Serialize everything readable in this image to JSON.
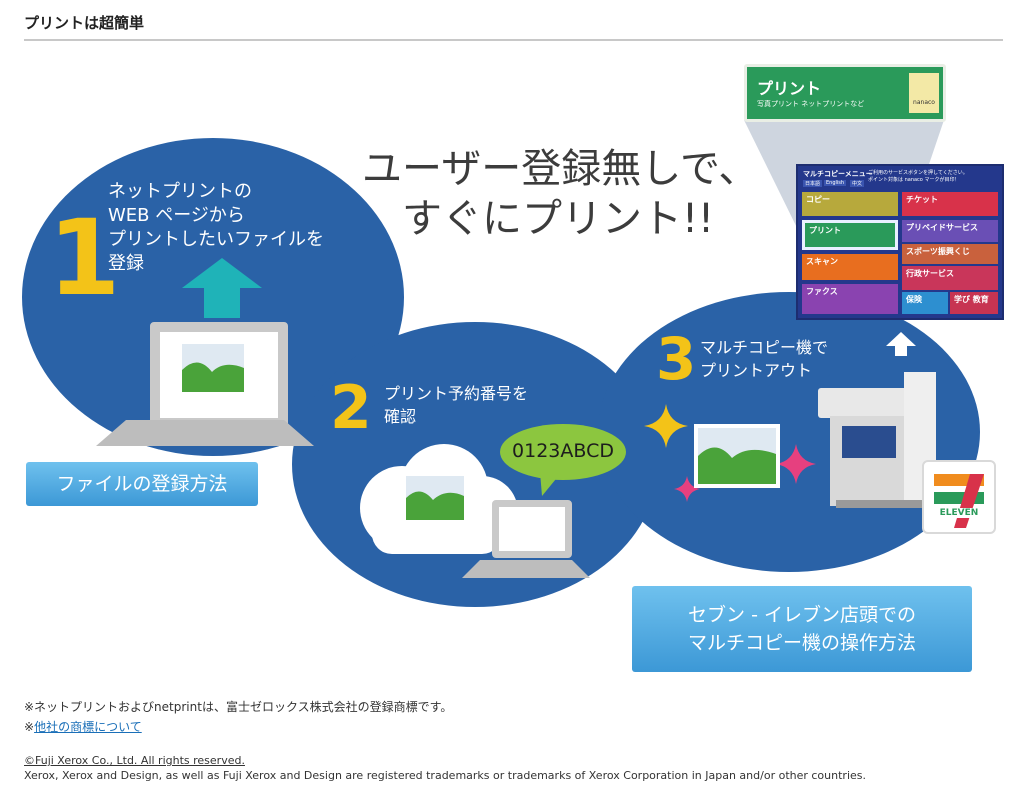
{
  "page": {
    "title": "プリントは超簡単"
  },
  "headline": {
    "line1": "ユーザー登録無しで、",
    "line2": "すぐにプリント!!"
  },
  "steps": [
    {
      "number": "1",
      "lines": [
        "ネットプリントの",
        "WEB ページから",
        "プリントしたいファイルを",
        "登録"
      ]
    },
    {
      "number": "2",
      "lines": [
        "プリント予約番号を",
        "確認"
      ]
    },
    {
      "number": "3",
      "lines": [
        "マルチコピー機で",
        "プリントアウト"
      ]
    }
  ],
  "reservation_code": "0123ABCD",
  "buttons": {
    "file_registration": "ファイルの登録方法",
    "seven_eleven_line1": "セブン - イレブン店頭での",
    "seven_eleven_line2": "マルチコピー機の操作方法"
  },
  "menu": {
    "zoom_title": "プリント",
    "zoom_subtitle": "写真プリント  ネットプリントなど",
    "header": "マルチコピーメニュー",
    "header_note_1": "ご利用のサービスボタンを押してください。",
    "header_note_2": "ポイント対象は nanaco マークが目印！",
    "lang_tabs": [
      "日本語",
      "English",
      "中文"
    ],
    "tiles": [
      {
        "label": "コピー",
        "color": "#b7a93c"
      },
      {
        "label": "チケット",
        "color": "#d8324a"
      },
      {
        "label": "プリント",
        "color": "#2a9a5a"
      },
      {
        "label": "プリペイドサービス",
        "color": "#6a4fb5"
      },
      {
        "label": "スキャン",
        "color": "#e86e1f"
      },
      {
        "label": "スポーツ振興くじ",
        "color": "#c9613d"
      },
      {
        "label": "ファクス",
        "color": "#8a43b0"
      },
      {
        "label": "行政サービス",
        "color": "#c9365a"
      },
      {
        "label": "保険",
        "color": "#2d8fd0"
      },
      {
        "label": "学び 教育",
        "color": "#c73452"
      }
    ],
    "nanaco": "nanaco"
  },
  "logo": {
    "text": "ELEVEN"
  },
  "notes": {
    "trademark_line": "※ネットプリントおよびnetprintは、富士ゼロックス株式会社の登録商標です。",
    "other_prefix": "※",
    "other_link": "他社の商標について"
  },
  "footer": {
    "copyright": "©Fuji Xerox Co., Ltd. All rights reserved.",
    "trademark": "Xerox, Xerox and Design, as well as Fuji Xerox and Design are registered trademarks or trademarks of Xerox Corporation in Japan and/or other countries."
  },
  "colors": {
    "blob": "#2a62a7",
    "step_number": "#f3c318",
    "arrow": "#1fb3b8",
    "button_top": "#6fc1ee",
    "button_bottom": "#3c98d6",
    "bubble": "#8cc63f"
  }
}
